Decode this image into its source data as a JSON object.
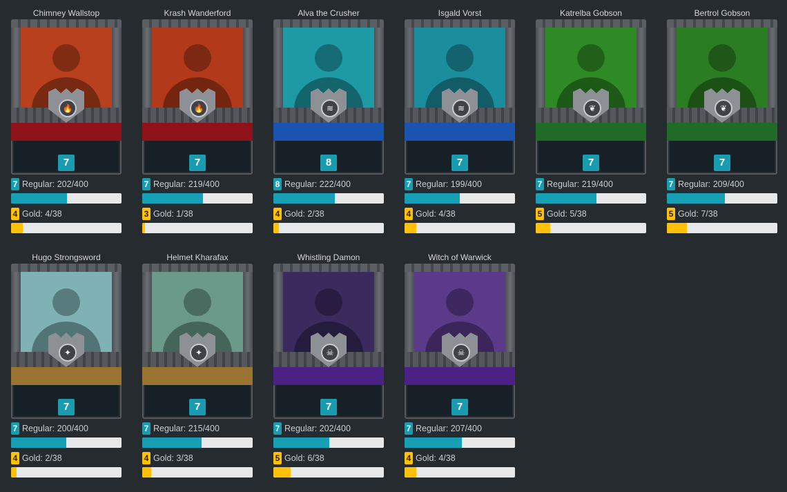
{
  "colors": {
    "regular": "#17a0b5",
    "gold": "#ffc107",
    "background": "#262b30"
  },
  "cards": [
    {
      "name": "Chimney Wallstop",
      "level": "7",
      "regular_level": "7",
      "regular_text": "Regular: 202/400",
      "regular_fraction": 0.505,
      "gold_level": "4",
      "gold_text": "Gold: 4/38",
      "gold_fraction": 0.105,
      "banner": "#8e1218",
      "bg": "#b8401c",
      "icon": "fire-icon",
      "glyph": "🔥"
    },
    {
      "name": "Krash Wanderford",
      "level": "7",
      "regular_level": "7",
      "regular_text": "Regular: 219/400",
      "regular_fraction": 0.5475,
      "gold_level": "3",
      "gold_text": "Gold: 1/38",
      "gold_fraction": 0.026,
      "banner": "#8e1218",
      "bg": "#b23a1a",
      "icon": "fire-icon",
      "glyph": "🔥"
    },
    {
      "name": "Alva the Crusher",
      "level": "8",
      "regular_level": "8",
      "regular_text": "Regular: 222/400",
      "regular_fraction": 0.555,
      "gold_level": "4",
      "gold_text": "Gold: 2/38",
      "gold_fraction": 0.053,
      "banner": "#1a54b0",
      "bg": "#1e9aa5",
      "icon": "water-icon",
      "glyph": "≋"
    },
    {
      "name": "Isgald Vorst",
      "level": "7",
      "regular_level": "7",
      "regular_text": "Regular: 199/400",
      "regular_fraction": 0.4975,
      "gold_level": "4",
      "gold_text": "Gold: 4/38",
      "gold_fraction": 0.105,
      "banner": "#1a54b0",
      "bg": "#1b8e9e",
      "icon": "water-icon",
      "glyph": "≋"
    },
    {
      "name": "Katrelba Gobson",
      "level": "7",
      "regular_level": "7",
      "regular_text": "Regular: 219/400",
      "regular_fraction": 0.5475,
      "gold_level": "5",
      "gold_text": "Gold: 5/38",
      "gold_fraction": 0.132,
      "banner": "#1f6b27",
      "bg": "#2e8a24",
      "icon": "leaf-icon",
      "glyph": "❦"
    },
    {
      "name": "Bertrol Gobson",
      "level": "7",
      "regular_level": "7",
      "regular_text": "Regular: 209/400",
      "regular_fraction": 0.5225,
      "gold_level": "5",
      "gold_text": "Gold: 7/38",
      "gold_fraction": 0.184,
      "banner": "#1f6b27",
      "bg": "#2b7d22",
      "icon": "leaf-icon",
      "glyph": "❦"
    },
    {
      "name": "Hugo Strongsword",
      "level": "7",
      "regular_level": "7",
      "regular_text": "Regular: 200/400",
      "regular_fraction": 0.5,
      "gold_level": "4",
      "gold_text": "Gold: 2/38",
      "gold_fraction": 0.053,
      "banner": "#9a7432",
      "bg": "#7fb2b5",
      "icon": "life-icon",
      "glyph": "✦"
    },
    {
      "name": "Helmet Kharafax",
      "level": "7",
      "regular_level": "7",
      "regular_text": "Regular: 215/400",
      "regular_fraction": 0.5375,
      "gold_level": "4",
      "gold_text": "Gold: 3/38",
      "gold_fraction": 0.079,
      "banner": "#9a7432",
      "bg": "#6b9a8a",
      "icon": "life-icon",
      "glyph": "✦"
    },
    {
      "name": "Whistling Damon",
      "level": "7",
      "regular_level": "7",
      "regular_text": "Regular: 202/400",
      "regular_fraction": 0.505,
      "gold_level": "5",
      "gold_text": "Gold: 6/38",
      "gold_fraction": 0.158,
      "banner": "#4b2186",
      "bg": "#3a2a5e",
      "icon": "death-icon",
      "glyph": "☠"
    },
    {
      "name": "Witch of Warwick",
      "level": "7",
      "regular_level": "7",
      "regular_text": "Regular: 207/400",
      "regular_fraction": 0.5175,
      "gold_level": "4",
      "gold_text": "Gold: 4/38",
      "gold_fraction": 0.105,
      "banner": "#4b2186",
      "bg": "#5b3a8a",
      "icon": "death-icon",
      "glyph": "☠"
    }
  ]
}
